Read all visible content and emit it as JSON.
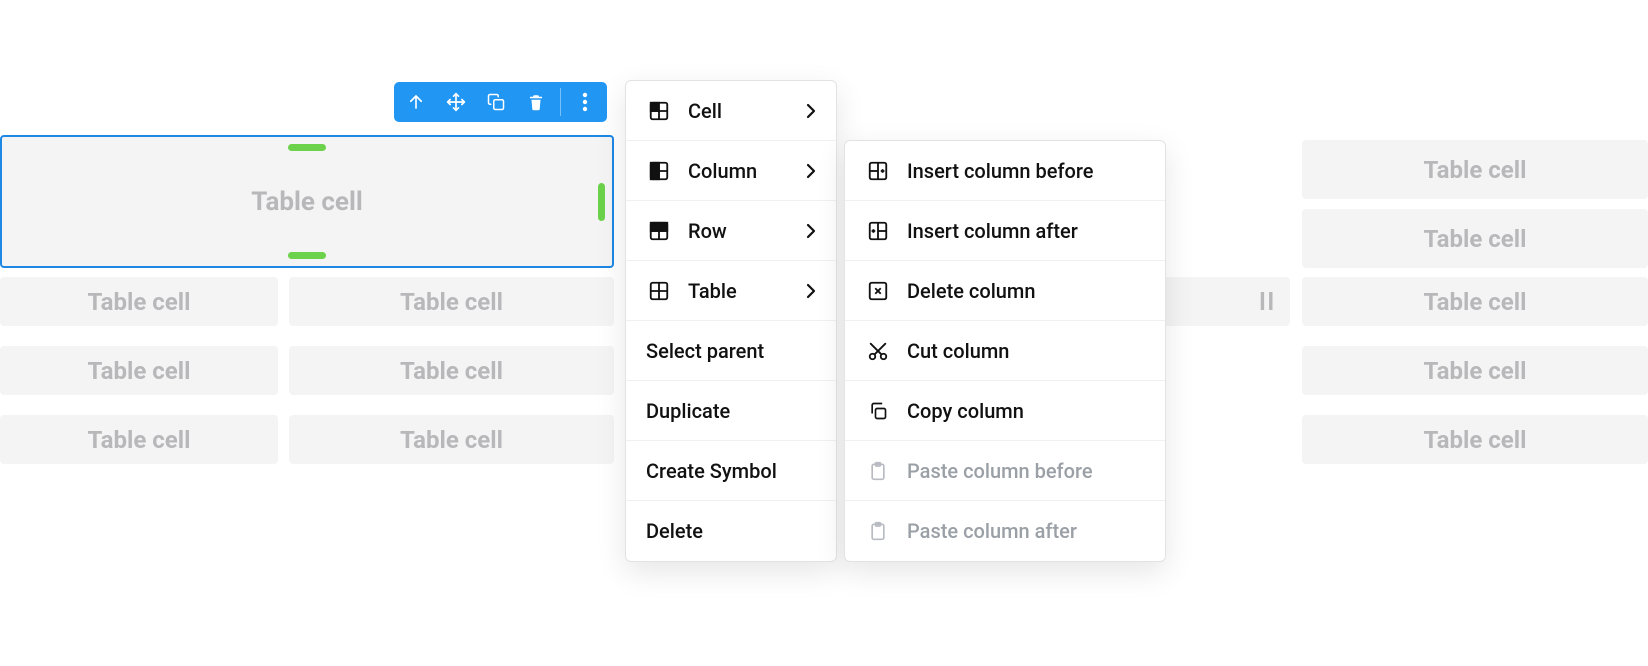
{
  "cells": {
    "placeholder": "Table cell",
    "selected_label": "Table cell"
  },
  "toolbar": {
    "icons": [
      "arrow-up",
      "move",
      "copy",
      "trash",
      "more"
    ]
  },
  "menu": {
    "items": [
      {
        "icon": "cell",
        "label": "Cell",
        "submenu": true
      },
      {
        "icon": "column",
        "label": "Column",
        "submenu": true
      },
      {
        "icon": "row",
        "label": "Row",
        "submenu": true
      },
      {
        "icon": "table",
        "label": "Table",
        "submenu": true
      },
      {
        "icon": null,
        "label": "Select parent",
        "submenu": false
      },
      {
        "icon": null,
        "label": "Duplicate",
        "submenu": false
      },
      {
        "icon": null,
        "label": "Create Symbol",
        "submenu": false
      },
      {
        "icon": null,
        "label": "Delete",
        "submenu": false
      }
    ]
  },
  "submenu_column": {
    "items": [
      {
        "icon": "insert-before",
        "label": "Insert column before",
        "disabled": false
      },
      {
        "icon": "insert-after",
        "label": "Insert column after",
        "disabled": false
      },
      {
        "icon": "delete-col",
        "label": "Delete column",
        "disabled": false
      },
      {
        "icon": "cut",
        "label": "Cut column",
        "disabled": false
      },
      {
        "icon": "copy",
        "label": "Copy column",
        "disabled": false
      },
      {
        "icon": "paste",
        "label": "Paste column before",
        "disabled": true
      },
      {
        "icon": "paste",
        "label": "Paste column after",
        "disabled": true
      }
    ]
  },
  "colors": {
    "accent": "#2196f3",
    "handle": "#6dd24b",
    "cell_bg": "#f4f4f5",
    "cell_text": "#b8b8ba",
    "disabled_text": "#9aa0a6"
  }
}
